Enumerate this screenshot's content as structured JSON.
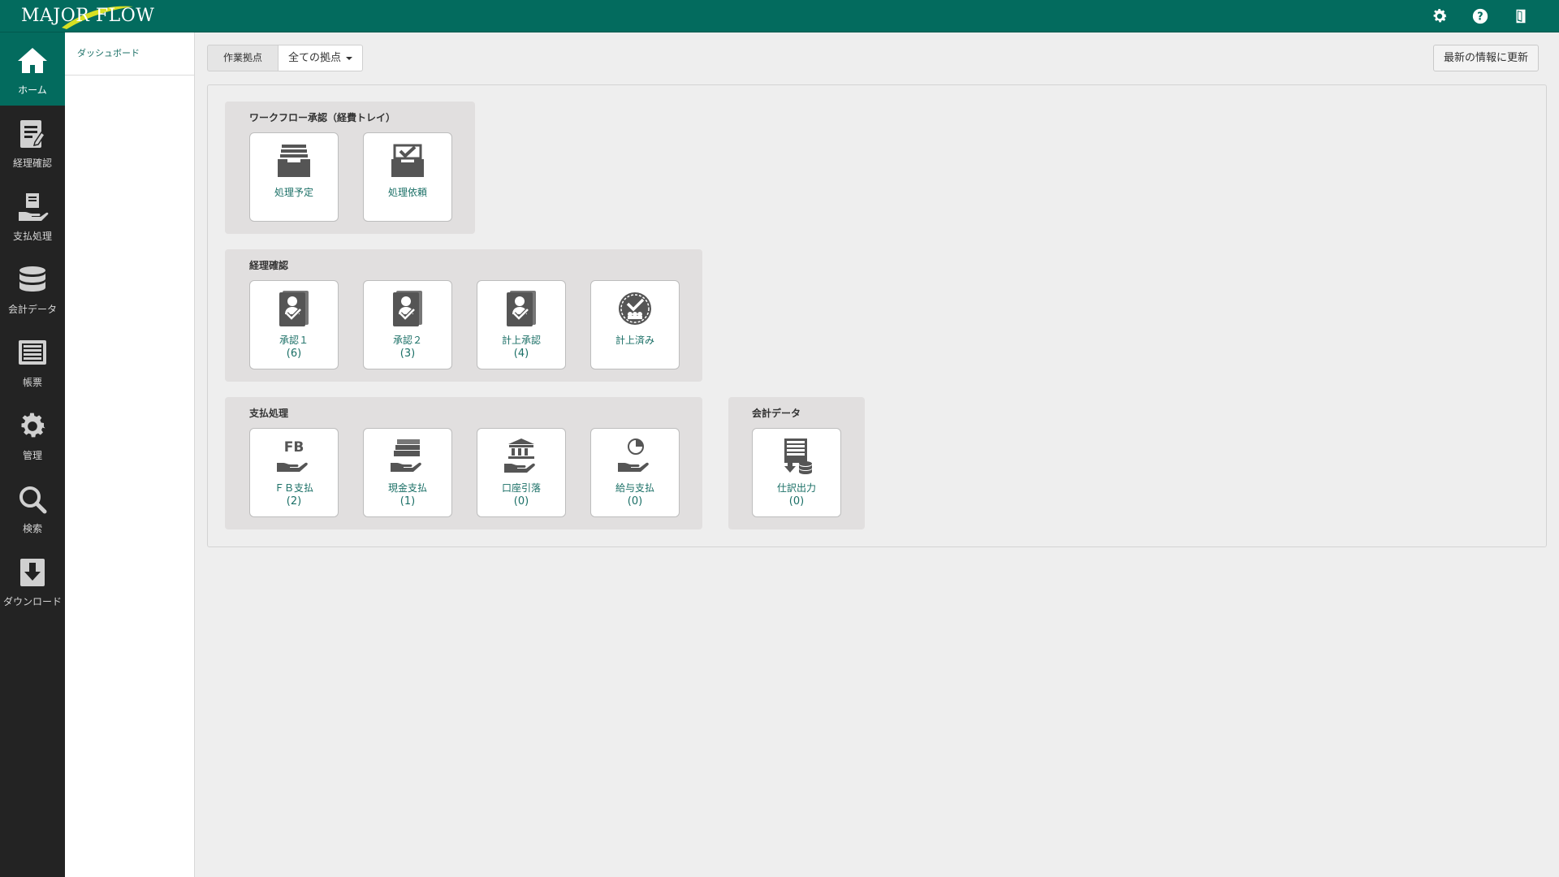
{
  "app": {
    "logo_text": "MAJOR FLOW"
  },
  "header": {
    "icons": [
      "gear-icon",
      "help-icon",
      "logout-icon"
    ]
  },
  "sidebar": {
    "items": [
      {
        "label": "ホーム",
        "icon": "home-icon",
        "active": true
      },
      {
        "label": "経理確認",
        "icon": "document-check-icon"
      },
      {
        "label": "支払処理",
        "icon": "payment-hand-icon"
      },
      {
        "label": "会計データ",
        "icon": "database-icon"
      },
      {
        "label": "帳票",
        "icon": "report-icon"
      },
      {
        "label": "管理",
        "icon": "gear-icon"
      },
      {
        "label": "検索",
        "icon": "search-icon"
      },
      {
        "label": "ダウンロード",
        "icon": "download-icon"
      }
    ]
  },
  "subpanel": {
    "crumb": "ダッシュボード"
  },
  "toolbar": {
    "location_label": "作業拠点",
    "location_value": "全ての拠点",
    "refresh_label": "最新の情報に更新"
  },
  "groups": {
    "workflow": {
      "title": "ワークフロー承認（経費トレイ）",
      "tiles": [
        {
          "label": "処理予定",
          "count": "",
          "icon": "inbox-stack-icon"
        },
        {
          "label": "処理依頼",
          "count": "",
          "icon": "inbox-check-icon"
        }
      ]
    },
    "accounting": {
      "title": "経理確認",
      "tiles": [
        {
          "label": "承認１",
          "count": "(6)",
          "icon": "approve-user-icon"
        },
        {
          "label": "承認２",
          "count": "(3)",
          "icon": "approve-user-icon"
        },
        {
          "label": "計上承認",
          "count": "(4)",
          "icon": "approve-user-icon"
        },
        {
          "label": "計上済み",
          "count": "",
          "icon": "certified-badge-icon"
        }
      ]
    },
    "payment": {
      "title": "支払処理",
      "tiles": [
        {
          "label": "ＦＢ支払",
          "count": "(2)",
          "icon": "fb-payment-icon"
        },
        {
          "label": "現金支払",
          "count": "(1)",
          "icon": "cash-payment-icon"
        },
        {
          "label": "口座引落",
          "count": "(0)",
          "icon": "bank-debit-icon"
        },
        {
          "label": "給与支払",
          "count": "(0)",
          "icon": "salary-payment-icon"
        }
      ]
    },
    "accounting_data": {
      "title": "会計データ",
      "tiles": [
        {
          "label": "仕訳出力",
          "count": "(0)",
          "icon": "journal-export-icon"
        }
      ]
    }
  },
  "colors": {
    "brand": "#036b5e",
    "sidebar": "#232323",
    "tile_text": "#1a6f66",
    "icon": "#555555"
  }
}
